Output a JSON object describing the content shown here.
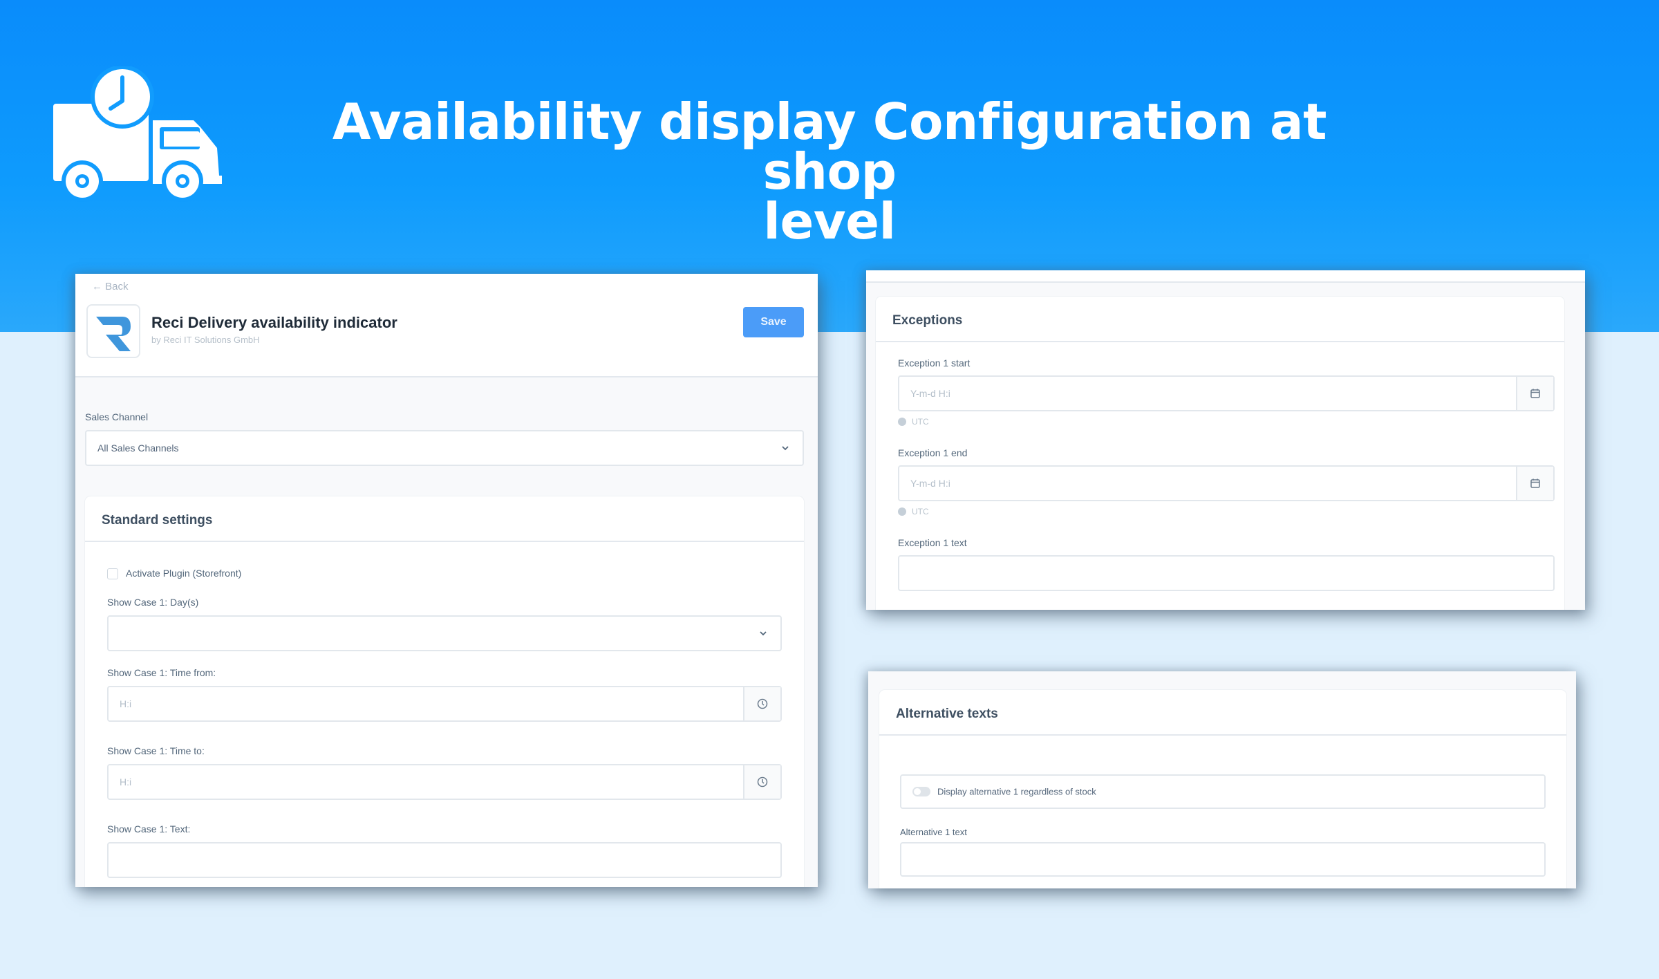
{
  "banner": {
    "title_line1": "Availability display Configuration at shop",
    "title_line2": "level",
    "icon": "delivery-truck-clock-icon",
    "colors": {
      "band": "#0e9bfd",
      "background": "#dff0fd"
    }
  },
  "plugin_page": {
    "back_label": "← Back",
    "app_name": "Reci Delivery availability indicator",
    "app_vendor": "by Reci IT Solutions GmbH",
    "save_label": "Save",
    "accent_color": "#4b9cf8",
    "sales_channel": {
      "label": "Sales Channel",
      "value": "All Sales Channels"
    },
    "standard_settings": {
      "title": "Standard settings",
      "activate_plugin_label": "Activate Plugin (Storefront)",
      "activate_plugin_checked": false,
      "days_label": "Show Case 1: Day(s)",
      "days_value": "",
      "time_from_label": "Show Case 1: Time from:",
      "time_from_placeholder": "H:i",
      "time_to_label": "Show Case 1: Time to:",
      "time_to_placeholder": "H:i",
      "text_label": "Show Case 1: Text:",
      "text_value": ""
    }
  },
  "exceptions": {
    "title": "Exceptions",
    "start_label": "Exception 1 start",
    "start_placeholder": "Y-m-d H:i",
    "start_hint": "UTC",
    "end_label": "Exception 1 end",
    "end_placeholder": "Y-m-d H:i",
    "end_hint": "UTC",
    "text_label": "Exception 1 text",
    "text_value": ""
  },
  "alternative_texts": {
    "title": "Alternative texts",
    "toggle_label": "Display alternative 1 regardless of stock",
    "toggle_on": false,
    "alt_text_label": "Alternative 1 text",
    "alt_text_value": ""
  }
}
